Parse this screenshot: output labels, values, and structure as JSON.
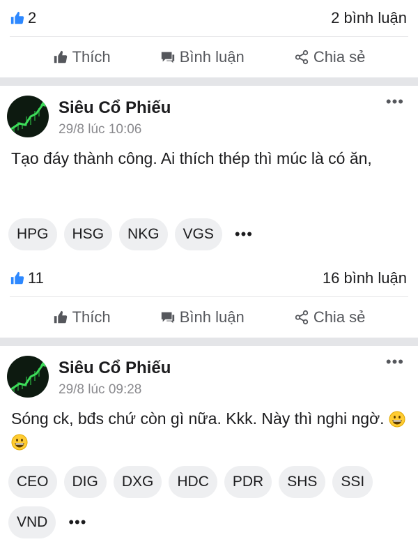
{
  "top": {
    "likes": "2",
    "comments": "2 bình luận"
  },
  "actions": {
    "like": "Thích",
    "comment": "Bình luận",
    "share": "Chia sẻ"
  },
  "posts": [
    {
      "author": "Siêu Cổ Phiếu",
      "time": "29/8 lúc 10:06",
      "text": "Tạo đáy thành công. Ai thích thép thì múc là có ăn,",
      "tags": [
        "HPG",
        "HSG",
        "NKG",
        "VGS"
      ],
      "more_tags": "•••",
      "likes": "11",
      "comments": "16 bình luận"
    },
    {
      "author": "Siêu Cổ Phiếu",
      "time": "29/8 lúc 09:28",
      "text": "Sóng ck, bđs chứ còn gì nữa. Kkk. Này thì nghi ngờ.",
      "emojis": [
        "grinning-face",
        "grinning-face"
      ],
      "tags": [
        "CEO",
        "DIG",
        "DXG",
        "HDC",
        "PDR",
        "SHS",
        "SSI",
        "VND"
      ],
      "more_tags": "•••"
    }
  ],
  "menu_icon": "•••",
  "colors": {
    "like_blue": "#2d88ff",
    "separator": "#e4e5e8",
    "tag_bg": "#eeeff1"
  }
}
